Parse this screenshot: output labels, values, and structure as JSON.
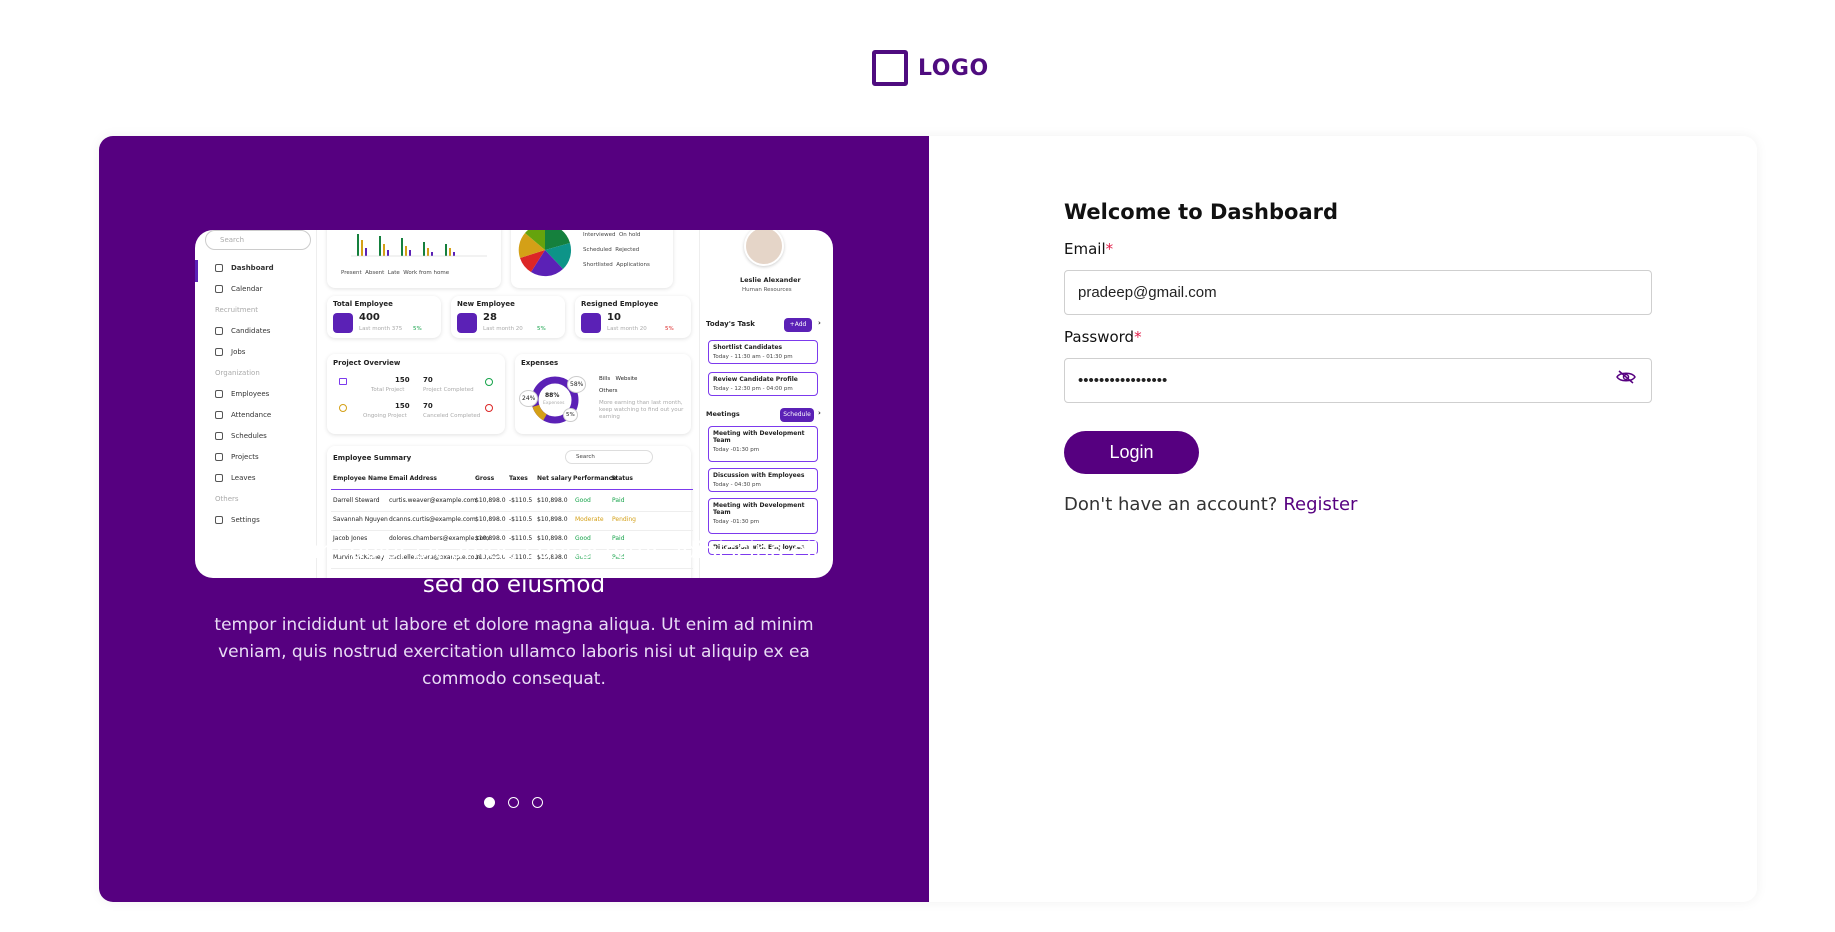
{
  "logo": {
    "text": "LOGO"
  },
  "preview": {
    "search": "Search",
    "nav": [
      {
        "label": "Dashboard",
        "group": false,
        "active": true
      },
      {
        "label": "Calendar",
        "group": false
      },
      {
        "label": "Recruitment",
        "group": true
      },
      {
        "label": "Candidates",
        "group": false
      },
      {
        "label": "Jobs",
        "group": false
      },
      {
        "label": "Organization",
        "group": true
      },
      {
        "label": "Employees",
        "group": false
      },
      {
        "label": "Attendance",
        "group": false
      },
      {
        "label": "Schedules",
        "group": false
      },
      {
        "label": "Projects",
        "group": false
      },
      {
        "label": "Leaves",
        "group": false
      },
      {
        "label": "Others",
        "group": true
      },
      {
        "label": "Settings",
        "group": false
      }
    ],
    "attendance_legend": [
      "Present",
      "Absent",
      "Late",
      "Work from home"
    ],
    "status_legend": [
      "Interviewed",
      "On hold",
      "Scheduled",
      "Rejected",
      "Shortlisted",
      "Applications"
    ],
    "stats": [
      {
        "title": "Total Employee",
        "value": "400",
        "sub": "Last month 375",
        "change": "5%"
      },
      {
        "title": "New Employee",
        "value": "28",
        "sub": "Last month 20",
        "change": "5%"
      },
      {
        "title": "Resigned Employee",
        "value": "10",
        "sub": "Last month 20",
        "change": "5%"
      }
    ],
    "project_overview": {
      "title": "Project Overview",
      "items": [
        {
          "value": "150",
          "label": "Total Project"
        },
        {
          "value": "70",
          "label": "Project Completed"
        },
        {
          "value": "150",
          "label": "Ongoing Project"
        },
        {
          "value": "70",
          "label": "Canceled Completed"
        }
      ]
    },
    "expenses": {
      "title": "Expenses",
      "center": "88%",
      "center_label": "Expenses",
      "bubbles": [
        "24%",
        "58%",
        "5%"
      ],
      "legend": [
        "Bills",
        "Website",
        "Others"
      ],
      "note": "More earning than last month, keep watching to find out your earning"
    },
    "summary": {
      "title": "Employee Summary",
      "search": "Search",
      "headers": [
        "Employee Name",
        "Email Address",
        "Gross",
        "Taxes",
        "Net salary",
        "Performance",
        "Status"
      ],
      "rows": [
        [
          "Darrell Steward",
          "curtis.weaver@example.com",
          "$10,898.0",
          "-$110.5",
          "$10,898.0",
          "Good",
          "Paid"
        ],
        [
          "Savannah Nguyen",
          "dcanns.curtis@example.com",
          "$10,898.0",
          "-$110.5",
          "$10,898.0",
          "Moderate",
          "Pending"
        ],
        [
          "Jacob Jones",
          "dolores.chambers@example.com",
          "$10,898.0",
          "-$110.5",
          "$10,898.0",
          "Good",
          "Paid"
        ],
        [
          "Marvin McKinney",
          "michelle.rivera@example.com",
          "$10,898.0",
          "-$110.5",
          "$10,898.0",
          "Good",
          "Paid"
        ]
      ]
    },
    "profile": {
      "name": "Leslie Alexander",
      "role": "Human Resources"
    },
    "todays_task": {
      "title": "Today's Task",
      "button": "+Add"
    },
    "tasks": [
      {
        "title": "Shortlist Candidates",
        "time": "Today - 11:30 am - 01:30 pm"
      },
      {
        "title": "Review Candidate Profile",
        "time": "Today - 12:30 pm - 04:00 pm"
      }
    ],
    "meetings": {
      "title": "Meetings",
      "button": "Schedule"
    },
    "meeting_items": [
      {
        "title": "Meeting with Development Team",
        "time": "Today -01:30 pm"
      },
      {
        "title": "Discussion with Employees",
        "time": "Today - 04:30 pm"
      },
      {
        "title": "Meeting with Development Team",
        "time": "Today -01:30 pm"
      },
      {
        "title": "Discussion with Employees",
        "time": ""
      }
    ]
  },
  "hero": {
    "heading": "Lorem ipsum dolor sit amet, consectetur adipiscing elit, sed do eiusmod",
    "body": "tempor incididunt ut labore et dolore magna aliqua. Ut enim ad minim veniam, quis nostrud exercitation ullamco laboris nisi ut aliquip ex ea commodo consequat.",
    "active_slide": 1,
    "slide_count": 3
  },
  "form": {
    "title": "Welcome to Dashboard",
    "email_label": "Email",
    "email_value": "pradeep@gmail.com",
    "password_label": "Password",
    "password_value": "pradeep@gmail.com",
    "required_mark": "*",
    "login_label": "Login",
    "register_prompt": "Don't have an account?",
    "register_link": "Register",
    "icons": {
      "password_toggle": "eye-off-icon"
    }
  },
  "colors": {
    "brand": "#560080",
    "accent": "#5b21b6",
    "required": "#e11d48"
  }
}
